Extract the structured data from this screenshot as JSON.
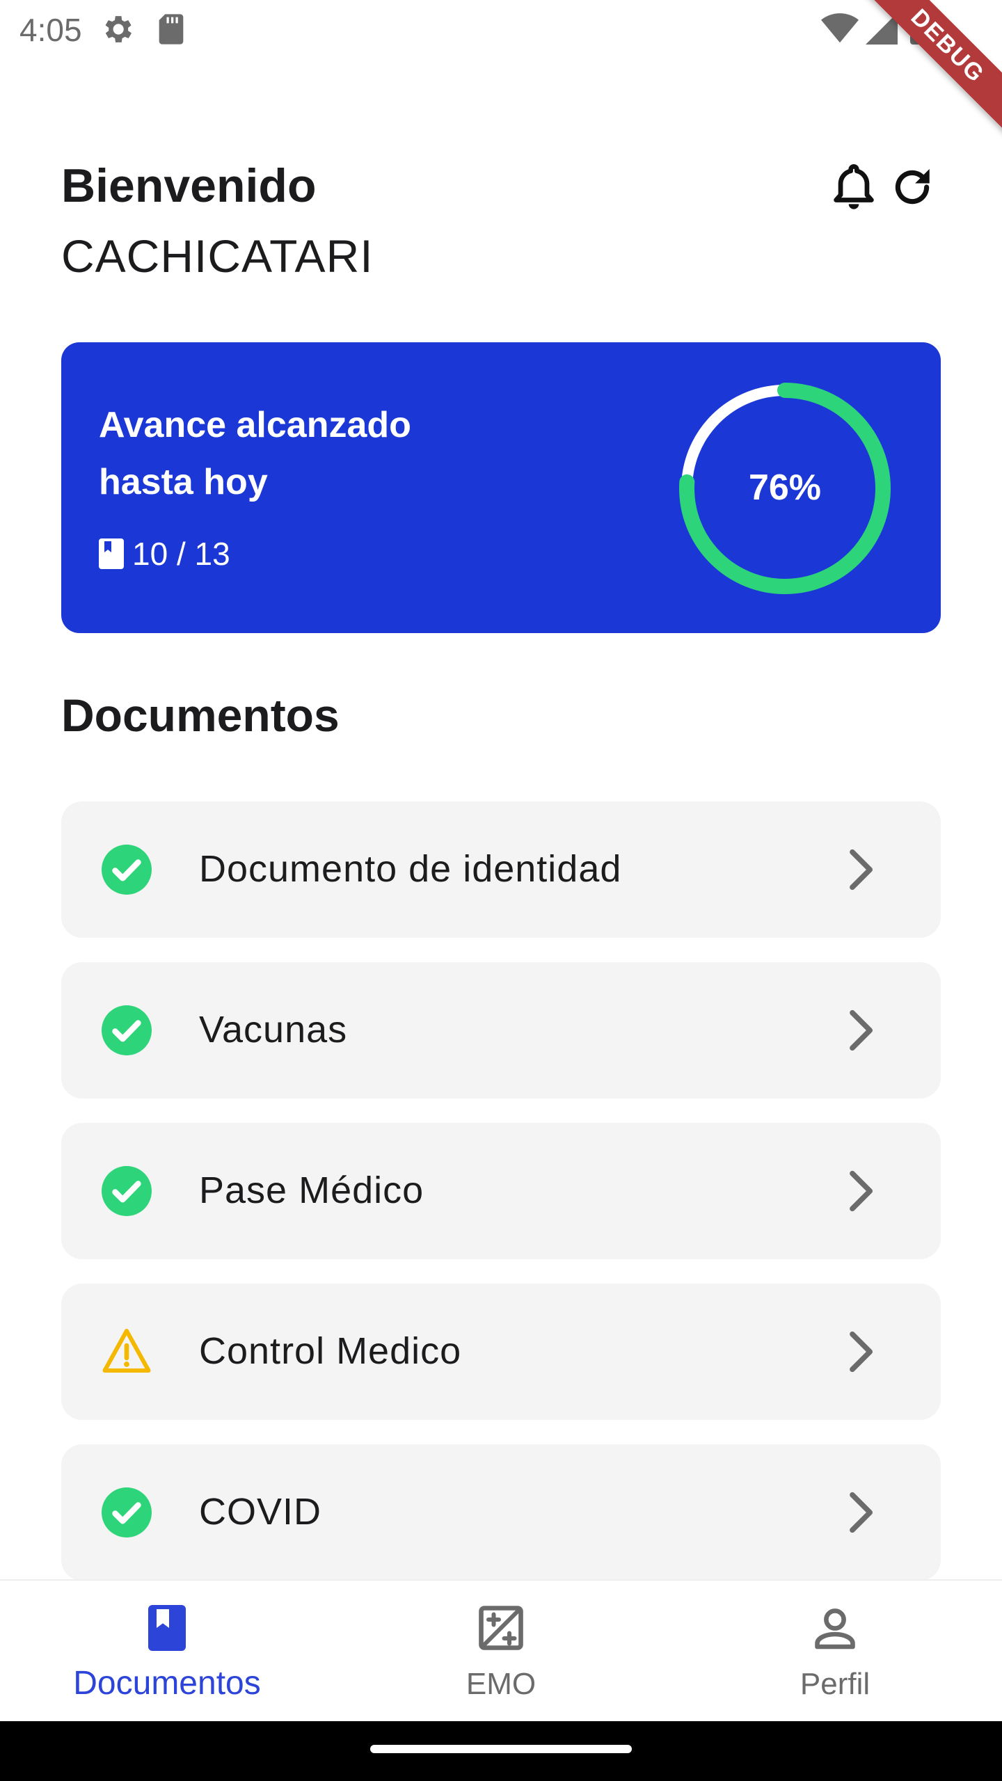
{
  "status_bar": {
    "time": "4:05",
    "left_icons": [
      "settings-icon",
      "sd-card-icon"
    ],
    "right_icons": [
      "wifi-icon",
      "signal-icon",
      "battery-icon"
    ]
  },
  "debug_banner": "DEBUG",
  "header": {
    "welcome": "Bienvenido",
    "username": "CACHICATARI",
    "icons": [
      "bell-icon",
      "refresh-icon"
    ]
  },
  "progress": {
    "title": "Avance alcanzado hasta hoy",
    "count_text": "10 / 13",
    "completed": 10,
    "total": 13,
    "percent_label": "76%",
    "percent_value": 76,
    "card_color": "#1b38d6",
    "ring_color": "#2ed47a",
    "ring_track_color": "#ffffff"
  },
  "documents": {
    "title": "Documentos",
    "items": [
      {
        "label": "Documento de identidad",
        "status": "complete",
        "icon": "check-circle-icon"
      },
      {
        "label": "Vacunas",
        "status": "complete",
        "icon": "check-circle-icon"
      },
      {
        "label": "Pase Médico",
        "status": "complete",
        "icon": "check-circle-icon"
      },
      {
        "label": "Control Medico",
        "status": "warning",
        "icon": "warning-icon"
      },
      {
        "label": "COVID",
        "status": "complete",
        "icon": "check-circle-icon"
      }
    ],
    "status_colors": {
      "complete": "#2ed47a",
      "warning": "#f5b800"
    }
  },
  "bottom_nav": {
    "items": [
      {
        "label": "Documentos",
        "icon": "bookmark-book-icon",
        "active": true
      },
      {
        "label": "EMO",
        "icon": "edit-square-icon",
        "active": false
      },
      {
        "label": "Perfil",
        "icon": "person-icon",
        "active": false
      }
    ],
    "active_color": "#2c45d8",
    "inactive_color": "#6b6b6b"
  }
}
